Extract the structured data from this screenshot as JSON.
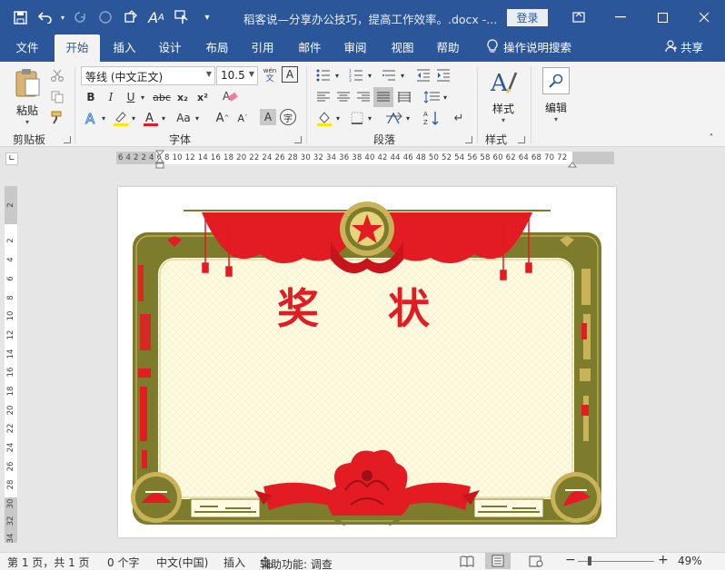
{
  "titlebar": {
    "title": "稻客说—分享办公技巧，提高工作效率。.docx  -...",
    "login_label": "登录",
    "icons": [
      "save-icon",
      "undo-icon",
      "redo-icon",
      "circle-icon",
      "format-painter-icon",
      "font-size-icon",
      "touch-mode-icon",
      "customize-icon"
    ]
  },
  "tabs": {
    "items": [
      "文件",
      "开始",
      "插入",
      "设计",
      "布局",
      "引用",
      "邮件",
      "审阅",
      "视图",
      "帮助"
    ],
    "active": "开始",
    "tellme": "操作说明搜索",
    "share": "共享"
  },
  "ribbon": {
    "clipboard": {
      "paste_label": "粘贴",
      "group_label": "剪贴板"
    },
    "font": {
      "font_name": "等线 (中文正文)",
      "font_size": "10.5",
      "bold": "B",
      "italic": "I",
      "underline": "U",
      "strike": "abc",
      "subscript": "x₂",
      "superscript": "x²",
      "case_label": "Aa",
      "grow": "A",
      "shrink": "A",
      "group_label": "字体"
    },
    "paragraph": {
      "group_label": "段落"
    },
    "styles": {
      "styles_label": "样式",
      "group_label": "样式"
    },
    "editing": {
      "edit_label": "编辑"
    }
  },
  "ruler": {
    "h_numbers": "6   4   2       2   4   6   8  10  12  14  16  18  20  22  24  26  28  30  32  34  36  38  40  42  44  46  48  50  52  54  56  58  60  62  64      68 70  72",
    "v_numbers": [
      "2",
      "2",
      "4",
      "6",
      "8",
      "10",
      "12",
      "14",
      "16",
      "18",
      "20",
      "22",
      "24",
      "26",
      "28",
      "30",
      "32",
      "34"
    ]
  },
  "document": {
    "certificate_title": "奖 状"
  },
  "statusbar": {
    "page": "第 1 页，共 1 页",
    "words": "0 个字",
    "language": "中文(中国)",
    "mode": "插入",
    "accessibility": "辅助功能: 调查",
    "zoom": "49%"
  },
  "colors": {
    "word_blue": "#2b579a",
    "cert_red": "#e31b23",
    "cert_olive": "#7d7b2c",
    "cert_gold": "#c9b35a",
    "cert_cream": "#fffbe3"
  }
}
